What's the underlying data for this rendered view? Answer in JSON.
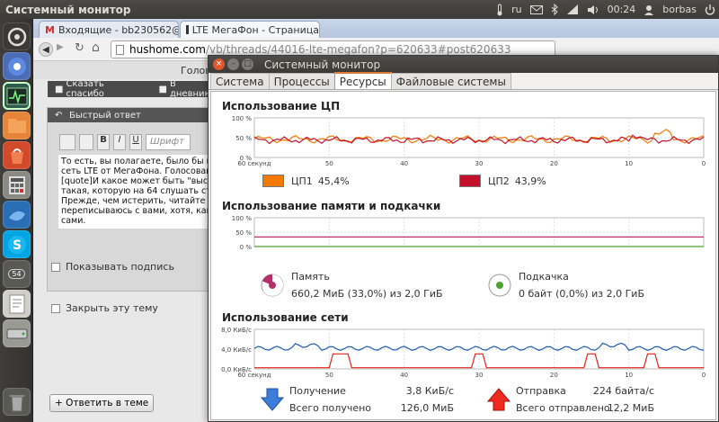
{
  "topbar": {
    "title": "Системный монитор",
    "keyboard": "ru",
    "clock": "00:24",
    "user": "borbas"
  },
  "launcher": {
    "badge": "54"
  },
  "browser": {
    "tabs": [
      {
        "label": "Входящие - bb230562@g"
      },
      {
        "label": "LTE МегаФон - Страница"
      }
    ],
    "url_host": "hushome.com",
    "url_path": "/vb/threads/44016-lte-megafon?p=620633#post620633"
  },
  "forum": {
    "head_partial": "Голова",
    "thanks_label": "Сказать спасибо",
    "diary_label": "В дневник",
    "quick_reply": "Быстрый ответ",
    "font_label": "Шрифт",
    "text_lines": [
      "То есть, вы полагаете, было бы прави",
      "сеть LTE от МегаФона. Голосование с",
      "[quote]И какое может быть \"высокое ка",
      "такая, которую на 64 слушать стошнит",
      "Прежде, чем истерить, читайте тариф",
      "переписываюсь с вами, хотя, как вы м",
      "сами."
    ],
    "show_signature": "Показывать подпись",
    "close_topic": "Закрыть эту тему",
    "reply_button": "+ Ответить в теме"
  },
  "sysmon": {
    "title": "Системный монитор",
    "tabs": [
      {
        "label": "Система"
      },
      {
        "label": "Процессы"
      },
      {
        "label": "Ресурсы"
      },
      {
        "label": "Файловые системы"
      }
    ],
    "cpu_title": "Использование ЦП",
    "cpu1_label": "ЦП1",
    "cpu1_value": "45,4%",
    "cpu2_label": "ЦП2",
    "cpu2_value": "43,9%",
    "mem_title": "Использование памяти и подкачки",
    "mem_label": "Память",
    "mem_value": "660,2 МиБ (33,0%) из 2,0 ГиБ",
    "swap_label": "Подкачка",
    "swap_value": "0 байт (0,0%) из 2,0 ГиБ",
    "net_title": "Использование сети",
    "recv_label": "Получение",
    "recv_rate": "3,8 КиБ/с",
    "recv_total_label": "Всего получено",
    "recv_total": "126,0 МиБ",
    "send_label": "Отправка",
    "send_rate": "224 байта/с",
    "send_total_label": "Всего отправлено",
    "send_total": "12,2 МиБ",
    "pct_ticks": [
      "100 %",
      "50 %",
      "0 %"
    ],
    "net_ticks": [
      "8,0 КиБ/с",
      "4,0 КиБ/с",
      "0,0 КиБ/с"
    ],
    "time_ticks": [
      "60 секунд",
      "50",
      "40",
      "30",
      "20",
      "10",
      "0"
    ],
    "colors": {
      "cpu1": "#f57900",
      "cpu2": "#c4102b",
      "memory": "#b5306b",
      "swap": "#4aa332",
      "recv": "#1e5cb3",
      "send": "#e0231b"
    }
  }
}
